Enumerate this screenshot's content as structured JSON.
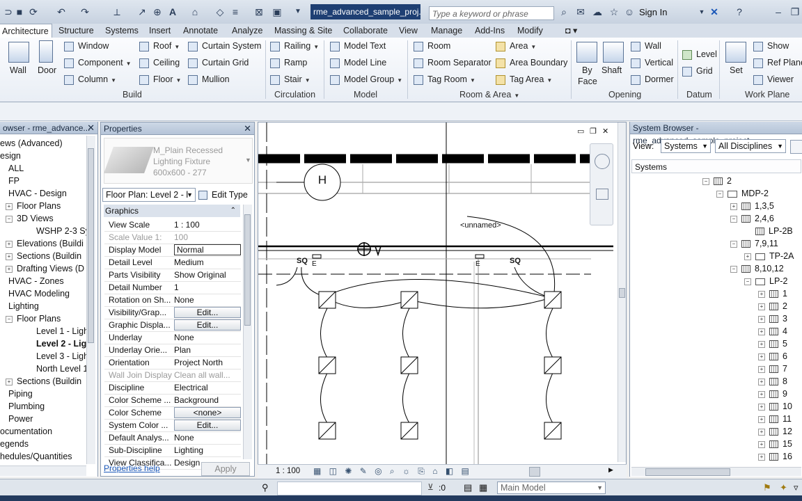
{
  "title_bar": {
    "document_title": "rme_advanced_sample_proj...",
    "search_placeholder": "Type a keyword or phrase",
    "sign_in": "Sign In"
  },
  "ribbon": {
    "tabs": [
      "Architecture",
      "Structure",
      "Systems",
      "Insert",
      "Annotate",
      "Analyze",
      "Massing & Site",
      "Collaborate",
      "View",
      "Manage",
      "Add-Ins",
      "Modify"
    ],
    "active_tab": "Architecture",
    "build": {
      "label": "Build",
      "wall": "Wall",
      "door": "Door",
      "window": "Window",
      "component": "Component",
      "column": "Column",
      "roof": "Roof",
      "ceiling": "Ceiling",
      "floor": "Floor",
      "curtain_system": "Curtain System",
      "curtain_grid": "Curtain Grid",
      "mullion": "Mullion"
    },
    "circulation": {
      "label": "Circulation",
      "railing": "Railing",
      "ramp": "Ramp",
      "stair": "Stair"
    },
    "model": {
      "label": "Model",
      "model_text": "Model Text",
      "model_line": "Model Line",
      "model_group": "Model Group"
    },
    "room_area": {
      "label": "Room & Area",
      "room": "Room",
      "room_separator": "Room Separator",
      "tag_room": "Tag Room",
      "area": "Area",
      "area_boundary": "Area Boundary",
      "tag_area": "Tag Area"
    },
    "opening": {
      "label": "Opening",
      "by_face_1": "By",
      "by_face_2": "Face",
      "shaft": "Shaft",
      "wall": "Wall",
      "vertical": "Vertical",
      "dormer": "Dormer"
    },
    "datum": {
      "label": "Datum",
      "level": "Level",
      "grid": "Grid"
    },
    "work_plane": {
      "label": "Work Plane",
      "set": "Set",
      "show": "Show",
      "ref_plane": "Ref Plane",
      "viewer": "Viewer"
    }
  },
  "project_browser": {
    "title": "owser - rme_advance...",
    "items": [
      {
        "label": "ews (Advanced)",
        "indent": 0,
        "bold": false,
        "exp": ""
      },
      {
        "label": "esign",
        "indent": 0,
        "bold": false,
        "exp": ""
      },
      {
        "label": "ALL",
        "indent": 1,
        "bold": false,
        "exp": ""
      },
      {
        "label": "FP",
        "indent": 1,
        "bold": false,
        "exp": ""
      },
      {
        "label": "HVAC - Design",
        "indent": 1,
        "bold": false,
        "exp": ""
      },
      {
        "label": "Floor Plans",
        "indent": 2,
        "bold": false,
        "exp": "+"
      },
      {
        "label": "3D Views",
        "indent": 2,
        "bold": false,
        "exp": "−"
      },
      {
        "label": "WSHP 2-3 Sy",
        "indent": 3,
        "bold": false,
        "exp": ""
      },
      {
        "label": "Elevations (Buildi",
        "indent": 2,
        "bold": false,
        "exp": "+"
      },
      {
        "label": "Sections (Buildin",
        "indent": 2,
        "bold": false,
        "exp": "+"
      },
      {
        "label": "Drafting Views (D",
        "indent": 2,
        "bold": false,
        "exp": "+"
      },
      {
        "label": "HVAC - Zones",
        "indent": 1,
        "bold": false,
        "exp": ""
      },
      {
        "label": "HVAC Modeling",
        "indent": 1,
        "bold": false,
        "exp": ""
      },
      {
        "label": "Lighting",
        "indent": 1,
        "bold": false,
        "exp": ""
      },
      {
        "label": "Floor Plans",
        "indent": 2,
        "bold": false,
        "exp": "−"
      },
      {
        "label": "Level 1 - Ligh",
        "indent": 3,
        "bold": false,
        "exp": ""
      },
      {
        "label": "Level 2 - Ligh",
        "indent": 3,
        "bold": true,
        "exp": ""
      },
      {
        "label": "Level 3 - Ligh",
        "indent": 3,
        "bold": false,
        "exp": ""
      },
      {
        "label": "North Level 1",
        "indent": 3,
        "bold": false,
        "exp": ""
      },
      {
        "label": "Sections (Buildin",
        "indent": 2,
        "bold": false,
        "exp": "+"
      },
      {
        "label": "Piping",
        "indent": 1,
        "bold": false,
        "exp": ""
      },
      {
        "label": "Plumbing",
        "indent": 1,
        "bold": false,
        "exp": ""
      },
      {
        "label": "Power",
        "indent": 1,
        "bold": false,
        "exp": ""
      },
      {
        "label": "ocumentation",
        "indent": 0,
        "bold": false,
        "exp": ""
      },
      {
        "label": "egends",
        "indent": 0,
        "bold": false,
        "exp": ""
      },
      {
        "label": "hedules/Quantities",
        "indent": 0,
        "bold": false,
        "exp": ""
      }
    ]
  },
  "properties": {
    "title": "Properties",
    "type_name_1": "M_Plain Recessed",
    "type_name_2": "Lighting Fixture",
    "type_name_3": "600x600 - 277",
    "view_selector": "Floor Plan: Level 2 - l",
    "edit_type": "Edit Type",
    "section": "Graphics",
    "rows": [
      {
        "name": "View Scale",
        "value": "1 : 100",
        "style": "",
        "grey": false
      },
      {
        "name": "Scale Value    1:",
        "value": "100",
        "style": "",
        "grey": true
      },
      {
        "name": "Display Model",
        "value": "Normal",
        "style": "box",
        "grey": false
      },
      {
        "name": "Detail Level",
        "value": "Medium",
        "style": "",
        "grey": false
      },
      {
        "name": "Parts Visibility",
        "value": "Show Original",
        "style": "",
        "grey": false
      },
      {
        "name": "Detail Number",
        "value": "1",
        "style": "",
        "grey": false
      },
      {
        "name": "Rotation on Sh...",
        "value": "None",
        "style": "",
        "grey": false
      },
      {
        "name": "Visibility/Grap...",
        "value": "Edit...",
        "style": "btn",
        "grey": false
      },
      {
        "name": "Graphic Displa...",
        "value": "Edit...",
        "style": "btn",
        "grey": false
      },
      {
        "name": "Underlay",
        "value": "None",
        "style": "",
        "grey": false
      },
      {
        "name": "Underlay Orie...",
        "value": "Plan",
        "style": "",
        "grey": false
      },
      {
        "name": "Orientation",
        "value": "Project North",
        "style": "",
        "grey": false
      },
      {
        "name": "Wall Join Display",
        "value": "Clean all wall...",
        "style": "",
        "grey": true
      },
      {
        "name": "Discipline",
        "value": "Electrical",
        "style": "",
        "grey": false
      },
      {
        "name": "Color Scheme ...",
        "value": "Background",
        "style": "",
        "grey": false
      },
      {
        "name": "Color Scheme",
        "value": "<none>",
        "style": "btn",
        "grey": false
      },
      {
        "name": "System Color ...",
        "value": "Edit...",
        "style": "btn",
        "grey": false
      },
      {
        "name": "Default Analys...",
        "value": "None",
        "style": "",
        "grey": false
      },
      {
        "name": "Sub-Discipline",
        "value": "Lighting",
        "style": "",
        "grey": false
      },
      {
        "name": "View Classifica...",
        "value": "Design",
        "style": "",
        "grey": false
      }
    ],
    "help": "Properties help",
    "apply": "Apply"
  },
  "canvas": {
    "grid_bubble": "H",
    "unnamed_label": "<unnamed>",
    "sq_label": "SQ",
    "e_label": "E",
    "scale": "1 : 100"
  },
  "system_browser": {
    "title": "System Browser - rme_advanced_sample_project",
    "view_label": "View:",
    "view_value": "Systems",
    "discipline_value": "All Disciplines",
    "column_header": "Systems",
    "items": [
      {
        "label": "2",
        "depth": 0,
        "exp": "−",
        "icon": "sys"
      },
      {
        "label": "MDP-2",
        "depth": 1,
        "exp": "−",
        "icon": "folder"
      },
      {
        "label": "1,3,5",
        "depth": 2,
        "exp": "+",
        "icon": "sys"
      },
      {
        "label": "2,4,6",
        "depth": 2,
        "exp": "−",
        "icon": "sys"
      },
      {
        "label": "LP-2B",
        "depth": 3,
        "exp": "",
        "icon": "sys"
      },
      {
        "label": "7,9,11",
        "depth": 2,
        "exp": "−",
        "icon": "sys"
      },
      {
        "label": "TP-2A",
        "depth": 3,
        "exp": "+",
        "icon": "folder"
      },
      {
        "label": "8,10,12",
        "depth": 2,
        "exp": "−",
        "icon": "sys"
      },
      {
        "label": "LP-2",
        "depth": 3,
        "exp": "−",
        "icon": "folder"
      },
      {
        "label": "1",
        "depth": 4,
        "exp": "+",
        "icon": "sys"
      },
      {
        "label": "2",
        "depth": 4,
        "exp": "+",
        "icon": "sys"
      },
      {
        "label": "3",
        "depth": 4,
        "exp": "+",
        "icon": "sys"
      },
      {
        "label": "4",
        "depth": 4,
        "exp": "+",
        "icon": "sys"
      },
      {
        "label": "5",
        "depth": 4,
        "exp": "+",
        "icon": "sys"
      },
      {
        "label": "6",
        "depth": 4,
        "exp": "+",
        "icon": "sys"
      },
      {
        "label": "7",
        "depth": 4,
        "exp": "+",
        "icon": "sys"
      },
      {
        "label": "8",
        "depth": 4,
        "exp": "+",
        "icon": "sys"
      },
      {
        "label": "9",
        "depth": 4,
        "exp": "+",
        "icon": "sys"
      },
      {
        "label": "10",
        "depth": 4,
        "exp": "+",
        "icon": "sys"
      },
      {
        "label": "11",
        "depth": 4,
        "exp": "+",
        "icon": "sys"
      },
      {
        "label": "12",
        "depth": 4,
        "exp": "+",
        "icon": "sys"
      },
      {
        "label": "15",
        "depth": 4,
        "exp": "+",
        "icon": "sys"
      },
      {
        "label": "16",
        "depth": 4,
        "exp": "+",
        "icon": "sys"
      }
    ]
  },
  "status_bar": {
    "selection_count": ":0",
    "model_selector": "Main Model"
  },
  "colors": {
    "title_accent": "#1e3f73",
    "panel_header": "#b5c4d8"
  }
}
